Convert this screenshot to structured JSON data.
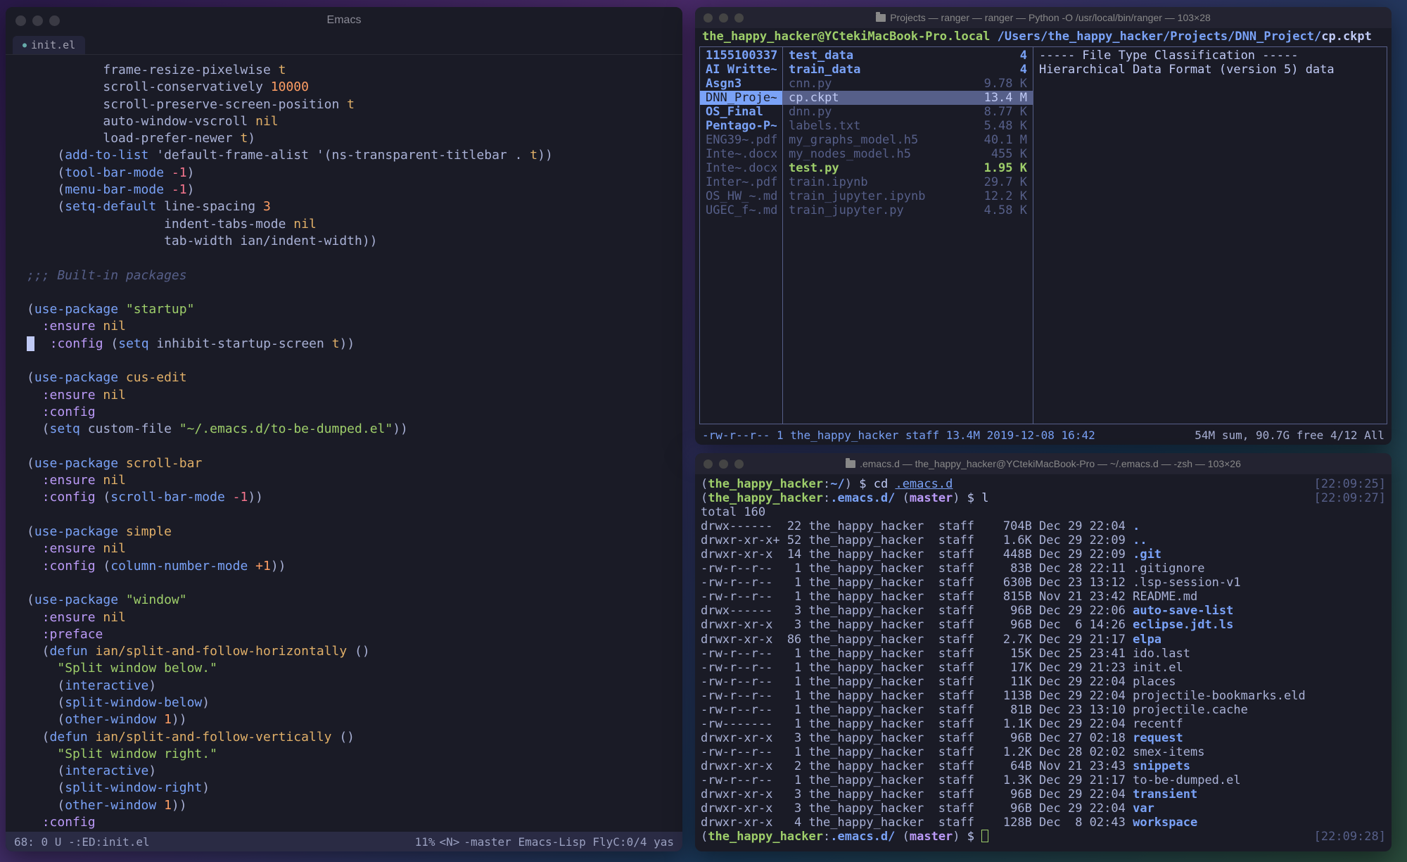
{
  "emacs": {
    "title": "Emacs",
    "tab_label": "init.el",
    "modeline": {
      "left": "68: 0 U -:ED:init.el",
      "percent": "11%",
      "right": "-master Emacs-Lisp FlyC:0/4 yas"
    },
    "code_lines": [
      [
        {
          "c": "",
          "t": "          frame-resize-pixelwise "
        },
        {
          "c": "c-nil",
          "t": "t"
        }
      ],
      [
        {
          "c": "",
          "t": "          scroll-conservatively "
        },
        {
          "c": "c-num",
          "t": "10000"
        }
      ],
      [
        {
          "c": "",
          "t": "          scroll-preserve-screen-position "
        },
        {
          "c": "c-nil",
          "t": "t"
        }
      ],
      [
        {
          "c": "",
          "t": "          auto-window-vscroll "
        },
        {
          "c": "c-nil",
          "t": "nil"
        }
      ],
      [
        {
          "c": "",
          "t": "          load-prefer-newer "
        },
        {
          "c": "c-nil",
          "t": "t"
        },
        {
          "c": "",
          "t": ")"
        }
      ],
      [
        {
          "c": "",
          "t": "    ("
        },
        {
          "c": "c-fn",
          "t": "add-to-list"
        },
        {
          "c": "",
          "t": " 'default-frame-alist '(ns-transparent-titlebar . "
        },
        {
          "c": "c-nil",
          "t": "t"
        },
        {
          "c": "",
          "t": "))"
        }
      ],
      [
        {
          "c": "",
          "t": "    ("
        },
        {
          "c": "c-fn",
          "t": "tool-bar-mode"
        },
        {
          "c": "",
          "t": " "
        },
        {
          "c": "c-neg",
          "t": "-1"
        },
        {
          "c": "",
          "t": ")"
        }
      ],
      [
        {
          "c": "",
          "t": "    ("
        },
        {
          "c": "c-fn",
          "t": "menu-bar-mode"
        },
        {
          "c": "",
          "t": " "
        },
        {
          "c": "c-neg",
          "t": "-1"
        },
        {
          "c": "",
          "t": ")"
        }
      ],
      [
        {
          "c": "",
          "t": "    ("
        },
        {
          "c": "c-fn",
          "t": "setq-default"
        },
        {
          "c": "",
          "t": " line-spacing "
        },
        {
          "c": "c-num",
          "t": "3"
        }
      ],
      [
        {
          "c": "",
          "t": "                  indent-tabs-mode "
        },
        {
          "c": "c-nil",
          "t": "nil"
        }
      ],
      [
        {
          "c": "",
          "t": "                  tab-width ian/indent-width))"
        }
      ],
      [],
      [
        {
          "c": "c-comment",
          "t": ";;; Built-in packages"
        }
      ],
      [],
      [
        {
          "c": "",
          "t": "("
        },
        {
          "c": "c-fn",
          "t": "use-package"
        },
        {
          "c": "",
          "t": " "
        },
        {
          "c": "c-str",
          "t": "\"startup\""
        }
      ],
      [
        {
          "c": "",
          "t": "  "
        },
        {
          "c": "c-kw",
          "t": ":ensure"
        },
        {
          "c": "",
          "t": " "
        },
        {
          "c": "c-nil",
          "t": "nil"
        }
      ],
      [
        {
          "c": "cursor-hint",
          "t": ""
        },
        {
          "c": "",
          "t": "  "
        },
        {
          "c": "c-kw",
          "t": ":config"
        },
        {
          "c": "",
          "t": " ("
        },
        {
          "c": "c-fn",
          "t": "setq"
        },
        {
          "c": "",
          "t": " inhibit-startup-screen "
        },
        {
          "c": "c-nil",
          "t": "t"
        },
        {
          "c": "",
          "t": "))"
        }
      ],
      [],
      [
        {
          "c": "",
          "t": "("
        },
        {
          "c": "c-fn",
          "t": "use-package"
        },
        {
          "c": "",
          "t": " "
        },
        {
          "c": "c-var",
          "t": "cus-edit"
        }
      ],
      [
        {
          "c": "",
          "t": "  "
        },
        {
          "c": "c-kw",
          "t": ":ensure"
        },
        {
          "c": "",
          "t": " "
        },
        {
          "c": "c-nil",
          "t": "nil"
        }
      ],
      [
        {
          "c": "",
          "t": "  "
        },
        {
          "c": "c-kw",
          "t": ":config"
        }
      ],
      [
        {
          "c": "",
          "t": "  ("
        },
        {
          "c": "c-fn",
          "t": "setq"
        },
        {
          "c": "",
          "t": " custom-file "
        },
        {
          "c": "c-str",
          "t": "\"~/.emacs.d/to-be-dumped.el\""
        },
        {
          "c": "",
          "t": "))"
        }
      ],
      [],
      [
        {
          "c": "",
          "t": "("
        },
        {
          "c": "c-fn",
          "t": "use-package"
        },
        {
          "c": "",
          "t": " "
        },
        {
          "c": "c-var",
          "t": "scroll-bar"
        }
      ],
      [
        {
          "c": "",
          "t": "  "
        },
        {
          "c": "c-kw",
          "t": ":ensure"
        },
        {
          "c": "",
          "t": " "
        },
        {
          "c": "c-nil",
          "t": "nil"
        }
      ],
      [
        {
          "c": "",
          "t": "  "
        },
        {
          "c": "c-kw",
          "t": ":config"
        },
        {
          "c": "",
          "t": " ("
        },
        {
          "c": "c-fn",
          "t": "scroll-bar-mode"
        },
        {
          "c": "",
          "t": " "
        },
        {
          "c": "c-neg",
          "t": "-1"
        },
        {
          "c": "",
          "t": "))"
        }
      ],
      [],
      [
        {
          "c": "",
          "t": "("
        },
        {
          "c": "c-fn",
          "t": "use-package"
        },
        {
          "c": "",
          "t": " "
        },
        {
          "c": "c-var",
          "t": "simple"
        }
      ],
      [
        {
          "c": "",
          "t": "  "
        },
        {
          "c": "c-kw",
          "t": ":ensure"
        },
        {
          "c": "",
          "t": " "
        },
        {
          "c": "c-nil",
          "t": "nil"
        }
      ],
      [
        {
          "c": "",
          "t": "  "
        },
        {
          "c": "c-kw",
          "t": ":config"
        },
        {
          "c": "",
          "t": " ("
        },
        {
          "c": "c-fn",
          "t": "column-number-mode"
        },
        {
          "c": "",
          "t": " "
        },
        {
          "c": "c-num",
          "t": "+1"
        },
        {
          "c": "",
          "t": "))"
        }
      ],
      [],
      [
        {
          "c": "",
          "t": "("
        },
        {
          "c": "c-fn",
          "t": "use-package"
        },
        {
          "c": "",
          "t": " "
        },
        {
          "c": "c-str",
          "t": "\"window\""
        }
      ],
      [
        {
          "c": "",
          "t": "  "
        },
        {
          "c": "c-kw",
          "t": ":ensure"
        },
        {
          "c": "",
          "t": " "
        },
        {
          "c": "c-nil",
          "t": "nil"
        }
      ],
      [
        {
          "c": "",
          "t": "  "
        },
        {
          "c": "c-kw",
          "t": ":preface"
        }
      ],
      [
        {
          "c": "",
          "t": "  ("
        },
        {
          "c": "c-fn",
          "t": "defun"
        },
        {
          "c": "",
          "t": " "
        },
        {
          "c": "c-var",
          "t": "ian/split-and-follow-horizontally"
        },
        {
          "c": "",
          "t": " ()"
        }
      ],
      [
        {
          "c": "",
          "t": "    "
        },
        {
          "c": "c-str",
          "t": "\"Split window below.\""
        }
      ],
      [
        {
          "c": "",
          "t": "    ("
        },
        {
          "c": "c-fn",
          "t": "interactive"
        },
        {
          "c": "",
          "t": ")"
        }
      ],
      [
        {
          "c": "",
          "t": "    ("
        },
        {
          "c": "c-fn",
          "t": "split-window-below"
        },
        {
          "c": "",
          "t": ")"
        }
      ],
      [
        {
          "c": "",
          "t": "    ("
        },
        {
          "c": "c-fn",
          "t": "other-window"
        },
        {
          "c": "",
          "t": " "
        },
        {
          "c": "c-num",
          "t": "1"
        },
        {
          "c": "",
          "t": "))"
        }
      ],
      [
        {
          "c": "",
          "t": "  ("
        },
        {
          "c": "c-fn",
          "t": "defun"
        },
        {
          "c": "",
          "t": " "
        },
        {
          "c": "c-var",
          "t": "ian/split-and-follow-vertically"
        },
        {
          "c": "",
          "t": " ()"
        }
      ],
      [
        {
          "c": "",
          "t": "    "
        },
        {
          "c": "c-str",
          "t": "\"Split window right.\""
        }
      ],
      [
        {
          "c": "",
          "t": "    ("
        },
        {
          "c": "c-fn",
          "t": "interactive"
        },
        {
          "c": "",
          "t": ")"
        }
      ],
      [
        {
          "c": "",
          "t": "    ("
        },
        {
          "c": "c-fn",
          "t": "split-window-right"
        },
        {
          "c": "",
          "t": ")"
        }
      ],
      [
        {
          "c": "",
          "t": "    ("
        },
        {
          "c": "c-fn",
          "t": "other-window"
        },
        {
          "c": "",
          "t": " "
        },
        {
          "c": "c-num",
          "t": "1"
        },
        {
          "c": "",
          "t": "))"
        }
      ],
      [
        {
          "c": "",
          "t": "  "
        },
        {
          "c": "c-kw",
          "t": ":config"
        }
      ]
    ]
  },
  "ranger": {
    "title": "Projects — ranger — ranger — Python -O /usr/local/bin/ranger — 103×28",
    "host": "the_happy_hacker@YCtekiMacBook-Pro.local",
    "path": "/Users/the_happy_hacker/Projects/DNN_Project/",
    "file": "cp.ckpt",
    "col1": [
      {
        "name": "1155100337",
        "cls": "dir"
      },
      {
        "name": "AI Writte~",
        "cls": "dir"
      },
      {
        "name": "Asgn3",
        "cls": "dir"
      },
      {
        "name": "DNN_Proje~",
        "cls": "sel"
      },
      {
        "name": "OS_Final",
        "cls": "dir"
      },
      {
        "name": "Pentago-P~",
        "cls": "dir"
      },
      {
        "name": "ENG39~.pdf",
        "cls": "dim"
      },
      {
        "name": "Inte~.docx",
        "cls": "dim"
      },
      {
        "name": "Inte~.docx",
        "cls": "dim"
      },
      {
        "name": "Inter~.pdf",
        "cls": "dim"
      },
      {
        "name": "OS_HW_~.md",
        "cls": "dim"
      },
      {
        "name": "UGEC_f~.md",
        "cls": "dim"
      }
    ],
    "col2": [
      {
        "name": "test_data",
        "size": "4",
        "cls": "dir"
      },
      {
        "name": "train_data",
        "size": "4",
        "cls": "dir"
      },
      {
        "name": "cnn.py",
        "size": "9.78 K",
        "cls": "dim"
      },
      {
        "name": "cp.ckpt",
        "size": "13.4 M",
        "cls": "selfile"
      },
      {
        "name": "dnn.py",
        "size": "8.77 K",
        "cls": "dim"
      },
      {
        "name": "labels.txt",
        "size": "5.48 K",
        "cls": "dim"
      },
      {
        "name": "my_graphs_model.h5",
        "size": "40.1 M",
        "cls": "dim"
      },
      {
        "name": "my_nodes_model.h5",
        "size": "455 K",
        "cls": "dim"
      },
      {
        "name": "test.py",
        "size": "1.95 K",
        "cls": "exec"
      },
      {
        "name": "train.ipynb",
        "size": "29.7 K",
        "cls": "dim"
      },
      {
        "name": "train_jupyter.ipynb",
        "size": "12.2 K",
        "cls": "dim"
      },
      {
        "name": "train_jupyter.py",
        "size": "4.58 K",
        "cls": "dim"
      }
    ],
    "col3": {
      "line1": "----- File Type Classification -----",
      "line2": "Hierarchical Data Format (version 5) data"
    },
    "footer": {
      "left": "-rw-r--r-- 1 the_happy_hacker staff 13.4M 2019-12-08 16:42",
      "right": "54M sum, 90.7G free  4/12  All"
    }
  },
  "zsh": {
    "title": ".emacs.d — the_happy_hacker@YCtekiMacBook-Pro — ~/.emacs.d — -zsh — 103×26",
    "prompt1": {
      "host": "the_happy_hacker",
      "path": "~/",
      "cmd": "cd ",
      "arg": ".emacs.d",
      "ts": "[22:09:25]"
    },
    "prompt2": {
      "host": "the_happy_hacker",
      "path": ".emacs.d/",
      "branch": "master",
      "cmd": "l",
      "ts": "[22:09:27]"
    },
    "total": "total 160",
    "ls": [
      {
        "perm": "drwx------",
        "n": "22",
        "u": "the_happy_hacker",
        "g": "staff",
        "s": " 704B",
        "d": "Dec 29 22:04",
        "name": ".",
        "cls": "dir"
      },
      {
        "perm": "drwxr-xr-x+",
        "n": "52",
        "u": "the_happy_hacker",
        "g": "staff",
        "s": " 1.6K",
        "d": "Dec 29 22:09",
        "name": "..",
        "cls": "dir"
      },
      {
        "perm": "drwxr-xr-x",
        "n": "14",
        "u": "the_happy_hacker",
        "g": "staff",
        "s": " 448B",
        "d": "Dec 29 22:09",
        "name": ".git",
        "cls": "dir"
      },
      {
        "perm": "-rw-r--r--",
        "n": " 1",
        "u": "the_happy_hacker",
        "g": "staff",
        "s": "  83B",
        "d": "Dec 28 22:11",
        "name": ".gitignore",
        "cls": ""
      },
      {
        "perm": "-rw-r--r--",
        "n": " 1",
        "u": "the_happy_hacker",
        "g": "staff",
        "s": " 630B",
        "d": "Dec 23 13:12",
        "name": ".lsp-session-v1",
        "cls": ""
      },
      {
        "perm": "-rw-r--r--",
        "n": " 1",
        "u": "the_happy_hacker",
        "g": "staff",
        "s": " 815B",
        "d": "Nov 21 23:42",
        "name": "README.md",
        "cls": ""
      },
      {
        "perm": "drwx------",
        "n": " 3",
        "u": "the_happy_hacker",
        "g": "staff",
        "s": "  96B",
        "d": "Dec 29 22:06",
        "name": "auto-save-list",
        "cls": "dir"
      },
      {
        "perm": "drwxr-xr-x",
        "n": " 3",
        "u": "the_happy_hacker",
        "g": "staff",
        "s": "  96B",
        "d": "Dec  6 14:26",
        "name": "eclipse.jdt.ls",
        "cls": "dir"
      },
      {
        "perm": "drwxr-xr-x",
        "n": "86",
        "u": "the_happy_hacker",
        "g": "staff",
        "s": " 2.7K",
        "d": "Dec 29 21:17",
        "name": "elpa",
        "cls": "dir"
      },
      {
        "perm": "-rw-r--r--",
        "n": " 1",
        "u": "the_happy_hacker",
        "g": "staff",
        "s": "  15K",
        "d": "Dec 25 23:41",
        "name": "ido.last",
        "cls": ""
      },
      {
        "perm": "-rw-r--r--",
        "n": " 1",
        "u": "the_happy_hacker",
        "g": "staff",
        "s": "  17K",
        "d": "Dec 29 21:23",
        "name": "init.el",
        "cls": ""
      },
      {
        "perm": "-rw-r--r--",
        "n": " 1",
        "u": "the_happy_hacker",
        "g": "staff",
        "s": "  11K",
        "d": "Dec 29 22:04",
        "name": "places",
        "cls": ""
      },
      {
        "perm": "-rw-r--r--",
        "n": " 1",
        "u": "the_happy_hacker",
        "g": "staff",
        "s": " 113B",
        "d": "Dec 29 22:04",
        "name": "projectile-bookmarks.eld",
        "cls": ""
      },
      {
        "perm": "-rw-r--r--",
        "n": " 1",
        "u": "the_happy_hacker",
        "g": "staff",
        "s": "  81B",
        "d": "Dec 23 13:10",
        "name": "projectile.cache",
        "cls": ""
      },
      {
        "perm": "-rw-------",
        "n": " 1",
        "u": "the_happy_hacker",
        "g": "staff",
        "s": " 1.1K",
        "d": "Dec 29 22:04",
        "name": "recentf",
        "cls": ""
      },
      {
        "perm": "drwxr-xr-x",
        "n": " 3",
        "u": "the_happy_hacker",
        "g": "staff",
        "s": "  96B",
        "d": "Dec 27 02:18",
        "name": "request",
        "cls": "dir"
      },
      {
        "perm": "-rw-r--r--",
        "n": " 1",
        "u": "the_happy_hacker",
        "g": "staff",
        "s": " 1.2K",
        "d": "Dec 28 02:02",
        "name": "smex-items",
        "cls": ""
      },
      {
        "perm": "drwxr-xr-x",
        "n": " 2",
        "u": "the_happy_hacker",
        "g": "staff",
        "s": "  64B",
        "d": "Nov 21 23:43",
        "name": "snippets",
        "cls": "dir"
      },
      {
        "perm": "-rw-r--r--",
        "n": " 1",
        "u": "the_happy_hacker",
        "g": "staff",
        "s": " 1.3K",
        "d": "Dec 29 21:17",
        "name": "to-be-dumped.el",
        "cls": ""
      },
      {
        "perm": "drwxr-xr-x",
        "n": " 3",
        "u": "the_happy_hacker",
        "g": "staff",
        "s": "  96B",
        "d": "Dec 29 22:04",
        "name": "transient",
        "cls": "dir"
      },
      {
        "perm": "drwxr-xr-x",
        "n": " 3",
        "u": "the_happy_hacker",
        "g": "staff",
        "s": "  96B",
        "d": "Dec 29 22:04",
        "name": "var",
        "cls": "dir"
      },
      {
        "perm": "drwxr-xr-x",
        "n": " 4",
        "u": "the_happy_hacker",
        "g": "staff",
        "s": " 128B",
        "d": "Dec  8 02:43",
        "name": "workspace",
        "cls": "dir"
      }
    ],
    "prompt3": {
      "host": "the_happy_hacker",
      "path": ".emacs.d/",
      "branch": "master",
      "ts": "[22:09:28]"
    }
  }
}
